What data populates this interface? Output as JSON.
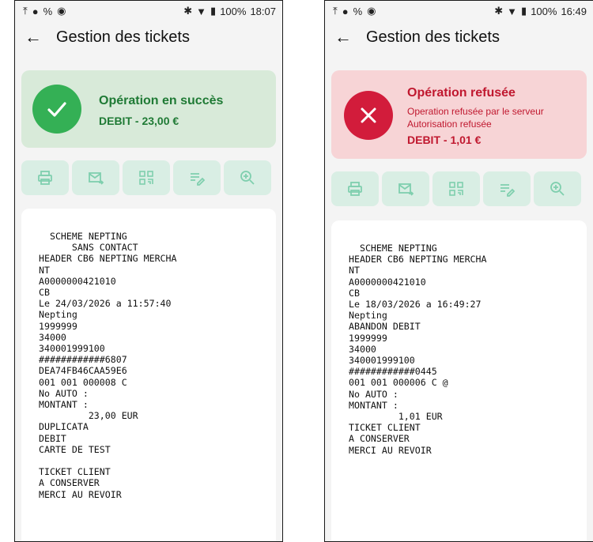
{
  "left": {
    "status": {
      "battery": "100%",
      "time": "18:07"
    },
    "appbar": {
      "title": "Gestion des tickets"
    },
    "result": {
      "title": "Opération en succès",
      "amount": "DEBIT - 23,00 €"
    },
    "actions": [
      "print-icon",
      "email-icon",
      "qr-code-icon",
      "edit-list-icon",
      "zoom-in-icon"
    ],
    "ticket": "  SCHEME NEPTING\n      SANS CONTACT\nHEADER CB6 NEPTING MERCHA\nNT\nA0000000421010\nCB\nLe 24/03/2026 a 11:57:40\nNepting\n1999999\n34000\n340001999100\n############6807\nDEA74FB46CAA59E6\n001 001 000008 C\nNo AUTO :\nMONTANT :\n         23,00 EUR\nDUPLICATA\nDEBIT\nCARTE DE TEST\n\nTICKET CLIENT\nA CONSERVER\nMERCI AU REVOIR"
  },
  "right": {
    "status": {
      "battery": "100%",
      "time": "16:49"
    },
    "appbar": {
      "title": "Gestion des tickets"
    },
    "result": {
      "title": "Opération refusée",
      "detail_1": "Operation refusée par le serveur",
      "detail_2": "Autorisation refusée",
      "amount": "DEBIT - 1,01 €"
    },
    "actions": [
      "print-icon",
      "email-icon",
      "qr-code-icon",
      "edit-list-icon",
      "zoom-in-icon"
    ],
    "ticket": "  SCHEME NEPTING\nHEADER CB6 NEPTING MERCHA\nNT\nA0000000421010\nCB\nLe 18/03/2026 a 16:49:27\nNepting\nABANDON DEBIT\n1999999\n34000\n340001999100\n############0445\n001 001 000006 C @\nNo AUTO :\nMONTANT :\n         1,01 EUR\nTICKET CLIENT\nA CONSERVER\nMERCI AU REVOIR"
  },
  "colors": {
    "success_bg": "#d8ead9",
    "success_accent": "#34b055",
    "success_text": "#1f7a35",
    "error_bg": "#f7d4d6",
    "error_accent": "#d21c3b",
    "error_text": "#c0182f",
    "action_bg": "#d9eee4",
    "action_icon": "#7fcfae"
  }
}
